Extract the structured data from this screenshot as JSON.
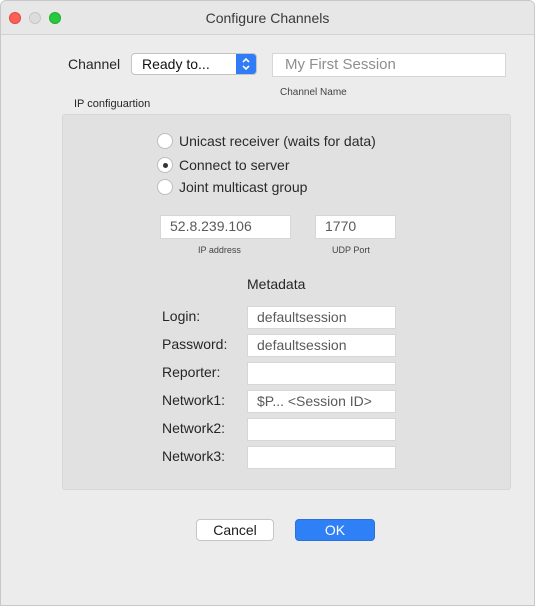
{
  "window": {
    "title": "Configure Channels"
  },
  "channel": {
    "label": "Channel",
    "selected": "Ready to...",
    "name_placeholder": "My First Session",
    "name_caption": "Channel Name"
  },
  "ip": {
    "section_label": "IP configuartion",
    "options": [
      {
        "label": "Unicast receiver (waits for data)",
        "checked": false
      },
      {
        "label": "Connect to server",
        "checked": true
      },
      {
        "label": "Joint multicast group",
        "checked": false
      }
    ],
    "address_value": "52.8.239.106",
    "address_caption": "IP address",
    "port_value": "1770",
    "port_caption": "UDP Port"
  },
  "metadata": {
    "title": "Metadata",
    "fields": [
      {
        "label": "Login:",
        "value": "defaultsession"
      },
      {
        "label": "Password:",
        "value": "defaultsession"
      },
      {
        "label": "Reporter:",
        "value": ""
      },
      {
        "label": "Network1:",
        "value": "$P... <Session ID>"
      },
      {
        "label": "Network2:",
        "value": ""
      },
      {
        "label": "Network3:",
        "value": ""
      }
    ]
  },
  "buttons": {
    "cancel": "Cancel",
    "ok": "OK"
  }
}
